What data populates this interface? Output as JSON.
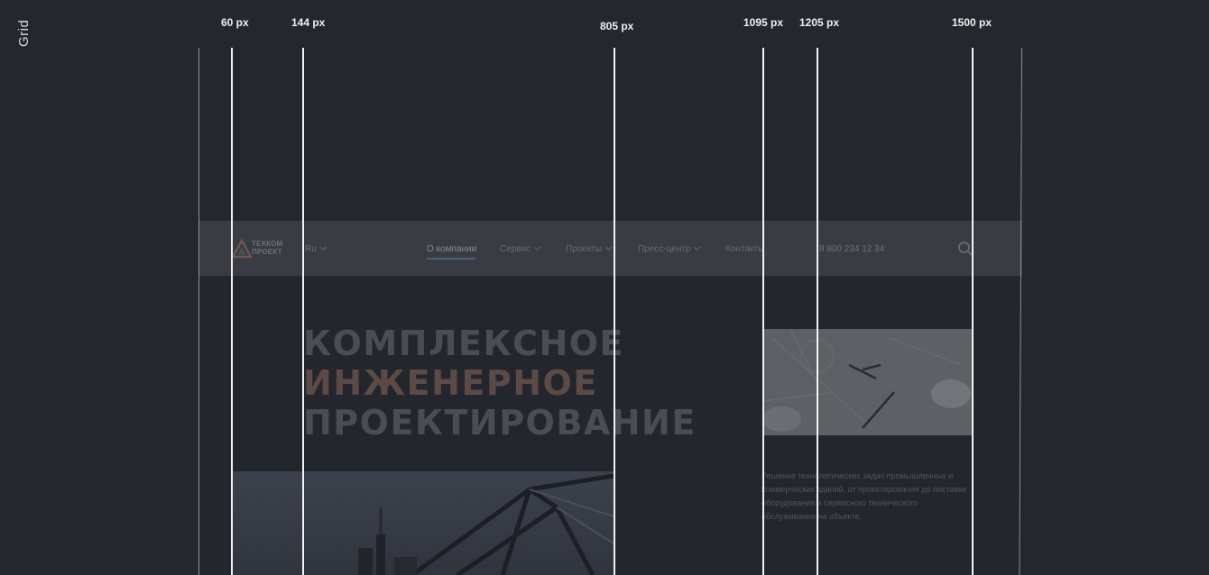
{
  "side_label": "Grid",
  "grid_labels": {
    "l60": "60 px",
    "l144": "144 px",
    "l805": "805 px",
    "l1095": "1095 px",
    "l1205": "1205 px",
    "l1500": "1500 px"
  },
  "site": {
    "logo_text": "ТЕХКОМ\nПРОЕКТ",
    "lang": "Ru",
    "nav": {
      "about": "О компании",
      "service": "Сервис",
      "projects": "Проекты",
      "press": "Пресс-центр",
      "contacts": "Контакты"
    },
    "phone": "8 800 234 12 34",
    "hero": {
      "line1": "КОМПЛЕКСНОЕ",
      "line2": "ИНЖЕНЕРНОЕ",
      "line3": "ПРОЕКТИРОВАНИЕ"
    },
    "description": "Решение технологических задач промышленных и коммерческих зданий, от проектирования до поставки оборудования и сервисного технического обслуживания на объекте."
  },
  "colors": {
    "background": "#25272e",
    "header": "#3a3c43",
    "accent": "#5c4a46",
    "grid_line": "#f2f2f2"
  }
}
